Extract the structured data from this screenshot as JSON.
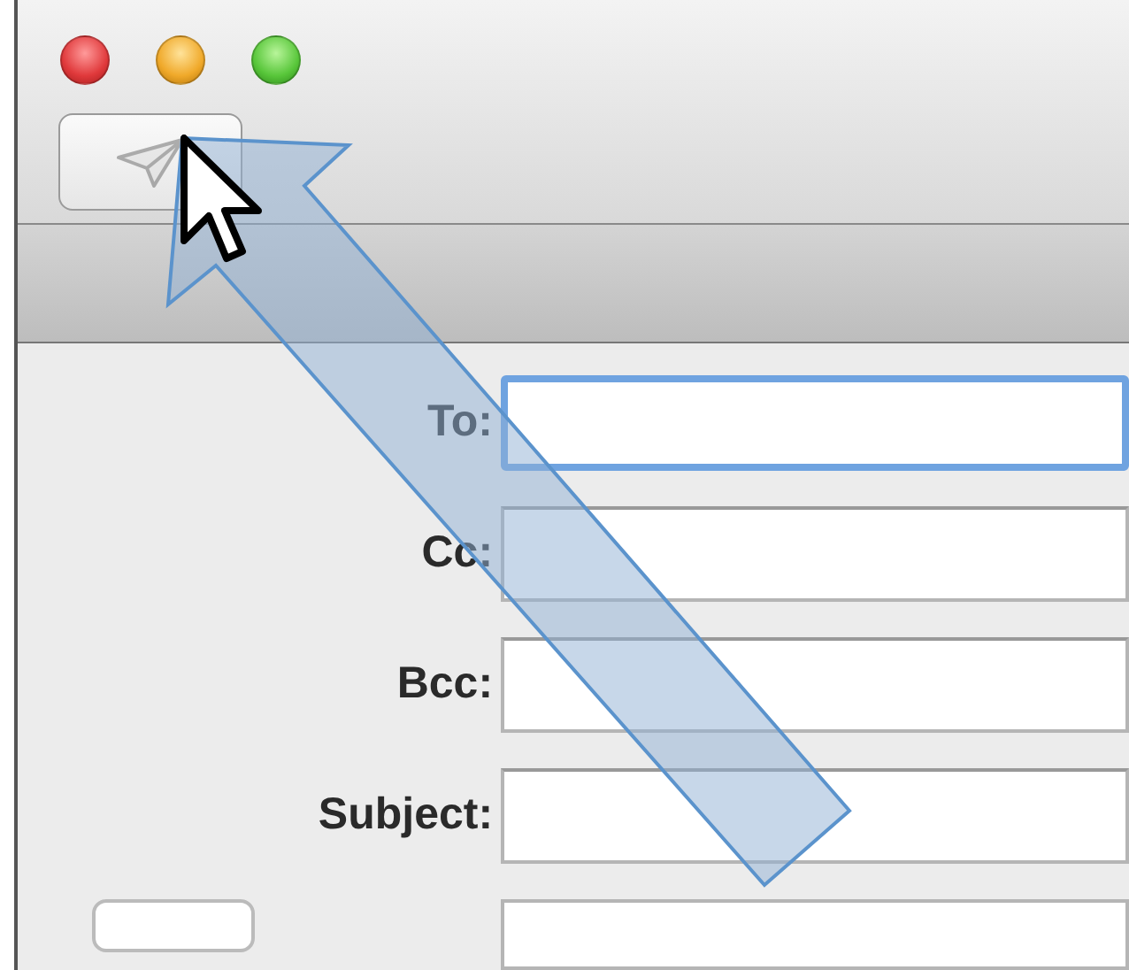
{
  "window": {
    "buttons": [
      {
        "kind": "close"
      },
      {
        "kind": "minimize"
      },
      {
        "kind": "zoom"
      }
    ]
  },
  "toolbar": {
    "send_button": {
      "disabled": true
    }
  },
  "fields": [
    {
      "label": "To:",
      "focused": true
    },
    {
      "label": "Cc:",
      "focused": false
    },
    {
      "label": "Bcc:",
      "focused": false
    },
    {
      "label": "Subject:",
      "focused": false
    }
  ]
}
